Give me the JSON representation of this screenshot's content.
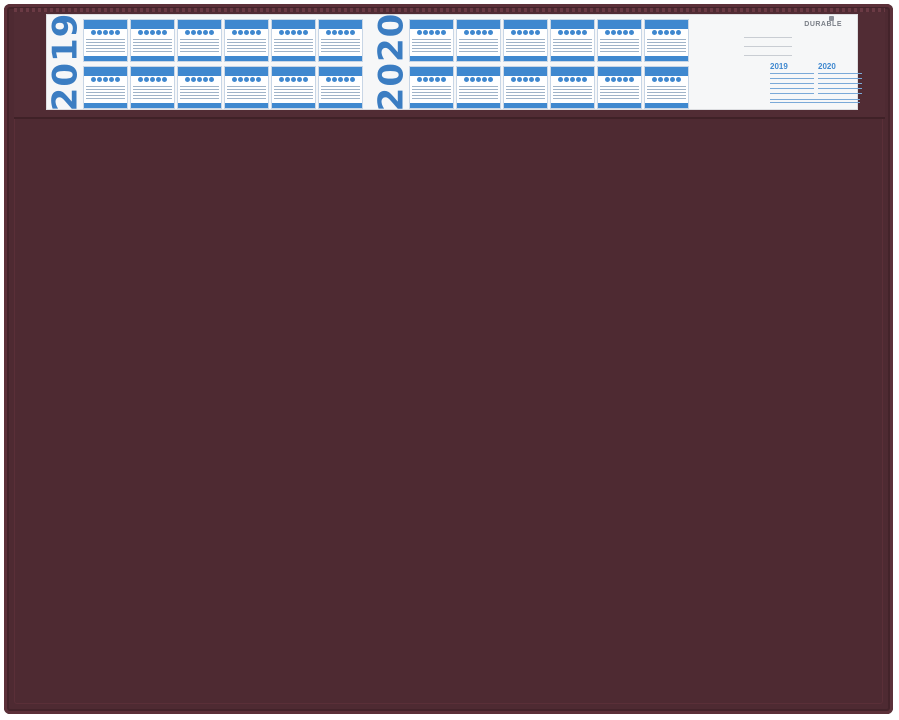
{
  "scene": {
    "colors": {
      "mat": "#4e2a32",
      "strip": "#f6f7f8",
      "accent": "#3f88cf"
    }
  },
  "calendar_strip": {
    "year_left": "2019",
    "year_right": "2020",
    "brand": "DURABLE",
    "side_year_1": "2019",
    "side_year_2": "2020"
  }
}
